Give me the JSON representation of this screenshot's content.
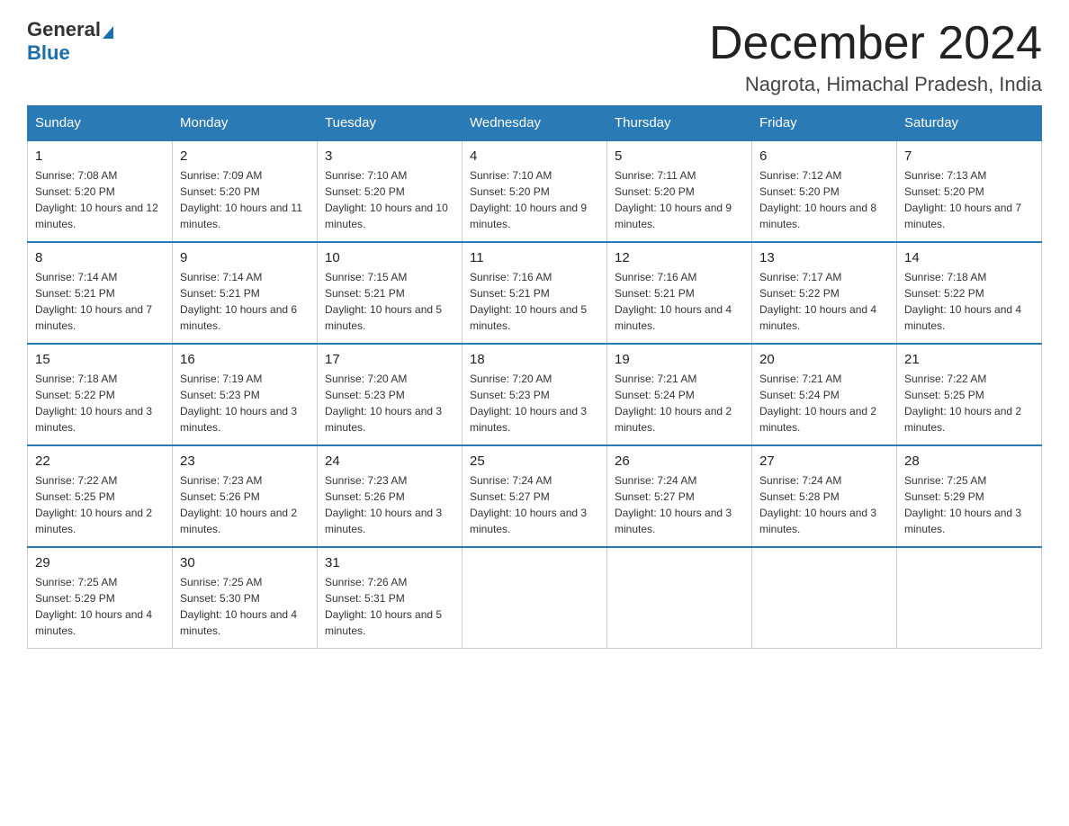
{
  "header": {
    "logo_general": "General",
    "logo_blue": "Blue",
    "month_title": "December 2024",
    "location": "Nagrota, Himachal Pradesh, India"
  },
  "weekdays": [
    "Sunday",
    "Monday",
    "Tuesday",
    "Wednesday",
    "Thursday",
    "Friday",
    "Saturday"
  ],
  "weeks": [
    [
      {
        "day": "1",
        "sunrise": "7:08 AM",
        "sunset": "5:20 PM",
        "daylight": "10 hours and 12 minutes."
      },
      {
        "day": "2",
        "sunrise": "7:09 AM",
        "sunset": "5:20 PM",
        "daylight": "10 hours and 11 minutes."
      },
      {
        "day": "3",
        "sunrise": "7:10 AM",
        "sunset": "5:20 PM",
        "daylight": "10 hours and 10 minutes."
      },
      {
        "day": "4",
        "sunrise": "7:10 AM",
        "sunset": "5:20 PM",
        "daylight": "10 hours and 9 minutes."
      },
      {
        "day": "5",
        "sunrise": "7:11 AM",
        "sunset": "5:20 PM",
        "daylight": "10 hours and 9 minutes."
      },
      {
        "day": "6",
        "sunrise": "7:12 AM",
        "sunset": "5:20 PM",
        "daylight": "10 hours and 8 minutes."
      },
      {
        "day": "7",
        "sunrise": "7:13 AM",
        "sunset": "5:20 PM",
        "daylight": "10 hours and 7 minutes."
      }
    ],
    [
      {
        "day": "8",
        "sunrise": "7:14 AM",
        "sunset": "5:21 PM",
        "daylight": "10 hours and 7 minutes."
      },
      {
        "day": "9",
        "sunrise": "7:14 AM",
        "sunset": "5:21 PM",
        "daylight": "10 hours and 6 minutes."
      },
      {
        "day": "10",
        "sunrise": "7:15 AM",
        "sunset": "5:21 PM",
        "daylight": "10 hours and 5 minutes."
      },
      {
        "day": "11",
        "sunrise": "7:16 AM",
        "sunset": "5:21 PM",
        "daylight": "10 hours and 5 minutes."
      },
      {
        "day": "12",
        "sunrise": "7:16 AM",
        "sunset": "5:21 PM",
        "daylight": "10 hours and 4 minutes."
      },
      {
        "day": "13",
        "sunrise": "7:17 AM",
        "sunset": "5:22 PM",
        "daylight": "10 hours and 4 minutes."
      },
      {
        "day": "14",
        "sunrise": "7:18 AM",
        "sunset": "5:22 PM",
        "daylight": "10 hours and 4 minutes."
      }
    ],
    [
      {
        "day": "15",
        "sunrise": "7:18 AM",
        "sunset": "5:22 PM",
        "daylight": "10 hours and 3 minutes."
      },
      {
        "day": "16",
        "sunrise": "7:19 AM",
        "sunset": "5:23 PM",
        "daylight": "10 hours and 3 minutes."
      },
      {
        "day": "17",
        "sunrise": "7:20 AM",
        "sunset": "5:23 PM",
        "daylight": "10 hours and 3 minutes."
      },
      {
        "day": "18",
        "sunrise": "7:20 AM",
        "sunset": "5:23 PM",
        "daylight": "10 hours and 3 minutes."
      },
      {
        "day": "19",
        "sunrise": "7:21 AM",
        "sunset": "5:24 PM",
        "daylight": "10 hours and 2 minutes."
      },
      {
        "day": "20",
        "sunrise": "7:21 AM",
        "sunset": "5:24 PM",
        "daylight": "10 hours and 2 minutes."
      },
      {
        "day": "21",
        "sunrise": "7:22 AM",
        "sunset": "5:25 PM",
        "daylight": "10 hours and 2 minutes."
      }
    ],
    [
      {
        "day": "22",
        "sunrise": "7:22 AM",
        "sunset": "5:25 PM",
        "daylight": "10 hours and 2 minutes."
      },
      {
        "day": "23",
        "sunrise": "7:23 AM",
        "sunset": "5:26 PM",
        "daylight": "10 hours and 2 minutes."
      },
      {
        "day": "24",
        "sunrise": "7:23 AM",
        "sunset": "5:26 PM",
        "daylight": "10 hours and 3 minutes."
      },
      {
        "day": "25",
        "sunrise": "7:24 AM",
        "sunset": "5:27 PM",
        "daylight": "10 hours and 3 minutes."
      },
      {
        "day": "26",
        "sunrise": "7:24 AM",
        "sunset": "5:27 PM",
        "daylight": "10 hours and 3 minutes."
      },
      {
        "day": "27",
        "sunrise": "7:24 AM",
        "sunset": "5:28 PM",
        "daylight": "10 hours and 3 minutes."
      },
      {
        "day": "28",
        "sunrise": "7:25 AM",
        "sunset": "5:29 PM",
        "daylight": "10 hours and 3 minutes."
      }
    ],
    [
      {
        "day": "29",
        "sunrise": "7:25 AM",
        "sunset": "5:29 PM",
        "daylight": "10 hours and 4 minutes."
      },
      {
        "day": "30",
        "sunrise": "7:25 AM",
        "sunset": "5:30 PM",
        "daylight": "10 hours and 4 minutes."
      },
      {
        "day": "31",
        "sunrise": "7:26 AM",
        "sunset": "5:31 PM",
        "daylight": "10 hours and 5 minutes."
      },
      null,
      null,
      null,
      null
    ]
  ]
}
